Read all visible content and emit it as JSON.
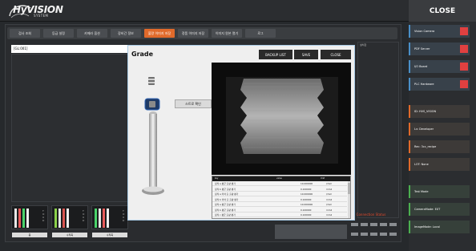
{
  "header": {
    "logo_text": "HyVISION",
    "logo_sub": "SYSTEM",
    "close_label": "CLOSE"
  },
  "tabs": [
    {
      "label": "검사 조회"
    },
    {
      "label": "등급 설정"
    },
    {
      "label": "카메라 옵션"
    },
    {
      "label": "장비간 정보"
    },
    {
      "label": "불량 이미지 저장",
      "active": true
    },
    {
      "label": "정품 이미지 저장"
    },
    {
      "label": "이미지 원본 열기"
    },
    {
      "label": "로그"
    }
  ],
  "left_panel": {
    "title": "[GL:001]"
  },
  "bar_groups": [
    {
      "label": "총",
      "letters": [
        "T",
        "O",
        "U",
        "D"
      ]
    },
    {
      "label": "수직축",
      "letters": [
        "T",
        "O",
        "U",
        "D"
      ]
    },
    {
      "label": "수직축",
      "letters": [
        "T",
        "O",
        "U",
        "D"
      ]
    }
  ],
  "bar_colors": [
    "#e8e8e8",
    "#e85a5a",
    "#4ad36a",
    "#f0f0f0",
    "#8bd14a",
    "#d9534f"
  ],
  "status": {
    "warning_text": "Connection Status",
    "right_header": "설치값"
  },
  "sidebar": {
    "items": [
      {
        "label": "Vision Camera",
        "style": "blue",
        "indicator": true
      },
      {
        "label": "PDF Server",
        "style": "blue",
        "indicator": true
      },
      {
        "label": "I/O Board",
        "style": "blue",
        "indicator": true
      },
      {
        "label": "PLC Hardware",
        "style": "blue",
        "indicator": true
      },
      {
        "label": "ID: HVS_VISION",
        "style": "orange"
      },
      {
        "label": "Lv: Developer",
        "style": "orange"
      },
      {
        "label": "Rec: 3cc_recipe",
        "style": "orange"
      },
      {
        "label": "LOT: None",
        "style": "orange"
      },
      {
        "label": "Test Mode",
        "style": "green"
      },
      {
        "label": "CameraMode: EXT",
        "style": "green"
      },
      {
        "label": "ImageMode: Local",
        "style": "green"
      }
    ]
  },
  "modal": {
    "title": "Grade",
    "backup_label": "BACKUP LIST",
    "save_label": "SAVE",
    "close_label": "CLOSE",
    "grade_button": "스트로 확인",
    "table": {
      "columns": [
        "key",
        "value",
        "Unit"
      ],
      "rows": [
        {
          "key": "정적 a 평균 출량 평가",
          "value": "10.000000",
          "unit": "l/mm"
        },
        {
          "key": "정적 b 평균 출량 평가",
          "value": "0.100000",
          "unit": "mm2"
        },
        {
          "key": "정적 a 카야 출 출량 평가",
          "value": "10.000000",
          "unit": "l/mm"
        },
        {
          "key": "정적 b 카야 출 출량 평가",
          "value": "0.100000",
          "unit": "mm2"
        },
        {
          "key": "정적 a 평균 출량 평가",
          "value": "10.000000",
          "unit": "l/mm"
        },
        {
          "key": "정적 b 평균 출량 평가",
          "value": "0.100000",
          "unit": "mm2"
        },
        {
          "key": "정적 c 평균 출량 평가",
          "value": "0.100000",
          "unit": "mm2"
        }
      ]
    }
  }
}
